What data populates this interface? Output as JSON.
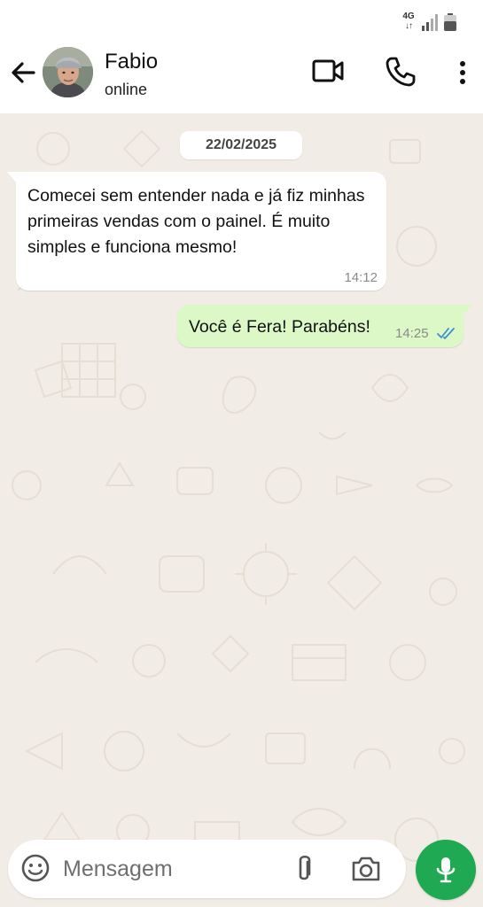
{
  "status_bar": {
    "network": "4G",
    "signal_icon": "signal-icon",
    "battery_icon": "battery-icon"
  },
  "header": {
    "contact_name": "Fabio",
    "contact_status": "online",
    "icons": [
      "back-arrow-icon",
      "video-call-icon",
      "phone-icon",
      "more-vert-icon"
    ]
  },
  "chat": {
    "date_label": "22/02/2025",
    "messages": [
      {
        "direction": "incoming",
        "text": "Comecei sem entender nada e já fiz minhas primeiras vendas com o painel. É muito simples e funciona mesmo!",
        "time": "14:12"
      },
      {
        "direction": "outgoing",
        "text": "Você é Fera! Parabéns!",
        "time": "14:25",
        "status_icon": "double-check-read-icon"
      }
    ]
  },
  "composer": {
    "placeholder": "Mensagem",
    "value": "",
    "icons": [
      "emoji-icon",
      "attach-icon",
      "camera-icon",
      "mic-icon"
    ]
  },
  "colors": {
    "chat_background": "#f1ede6",
    "outgoing_bubble": "#dcf8c6",
    "incoming_bubble": "#ffffff",
    "read_ticks": "#3a8fd6",
    "mic_button": "#1ea952"
  }
}
